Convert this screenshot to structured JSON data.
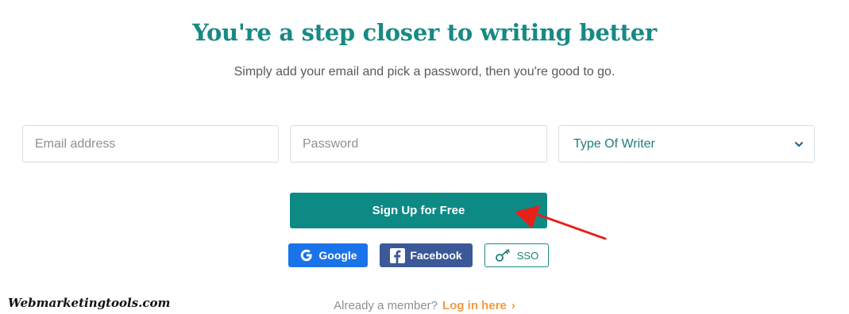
{
  "header": {
    "title": "You're a step closer to writing better",
    "subtitle": "Simply add your email and pick a password, then you're good to go."
  },
  "form": {
    "email_placeholder": "Email address",
    "password_placeholder": "Password",
    "writer_select_value": "Type Of Writer",
    "signup_label": "Sign Up for Free"
  },
  "social": {
    "google_label": "Google",
    "facebook_label": "Facebook",
    "sso_label": "SSO"
  },
  "footer": {
    "member_text": "Already a member?",
    "login_label": "Log in here",
    "login_arrow": "›"
  },
  "watermark": "Webmarketingtools.com",
  "icons": {
    "google": "google-g-icon",
    "facebook": "facebook-f-icon",
    "sso": "key-icon",
    "select": "chevron-down-icon",
    "annotation": "red-arrow-icon"
  },
  "colors": {
    "brand_teal": "#0e8a85",
    "google_blue": "#1a73e8",
    "facebook_blue": "#3b5998",
    "link_orange": "#f39a3c",
    "annotation_red": "#e8201a"
  }
}
